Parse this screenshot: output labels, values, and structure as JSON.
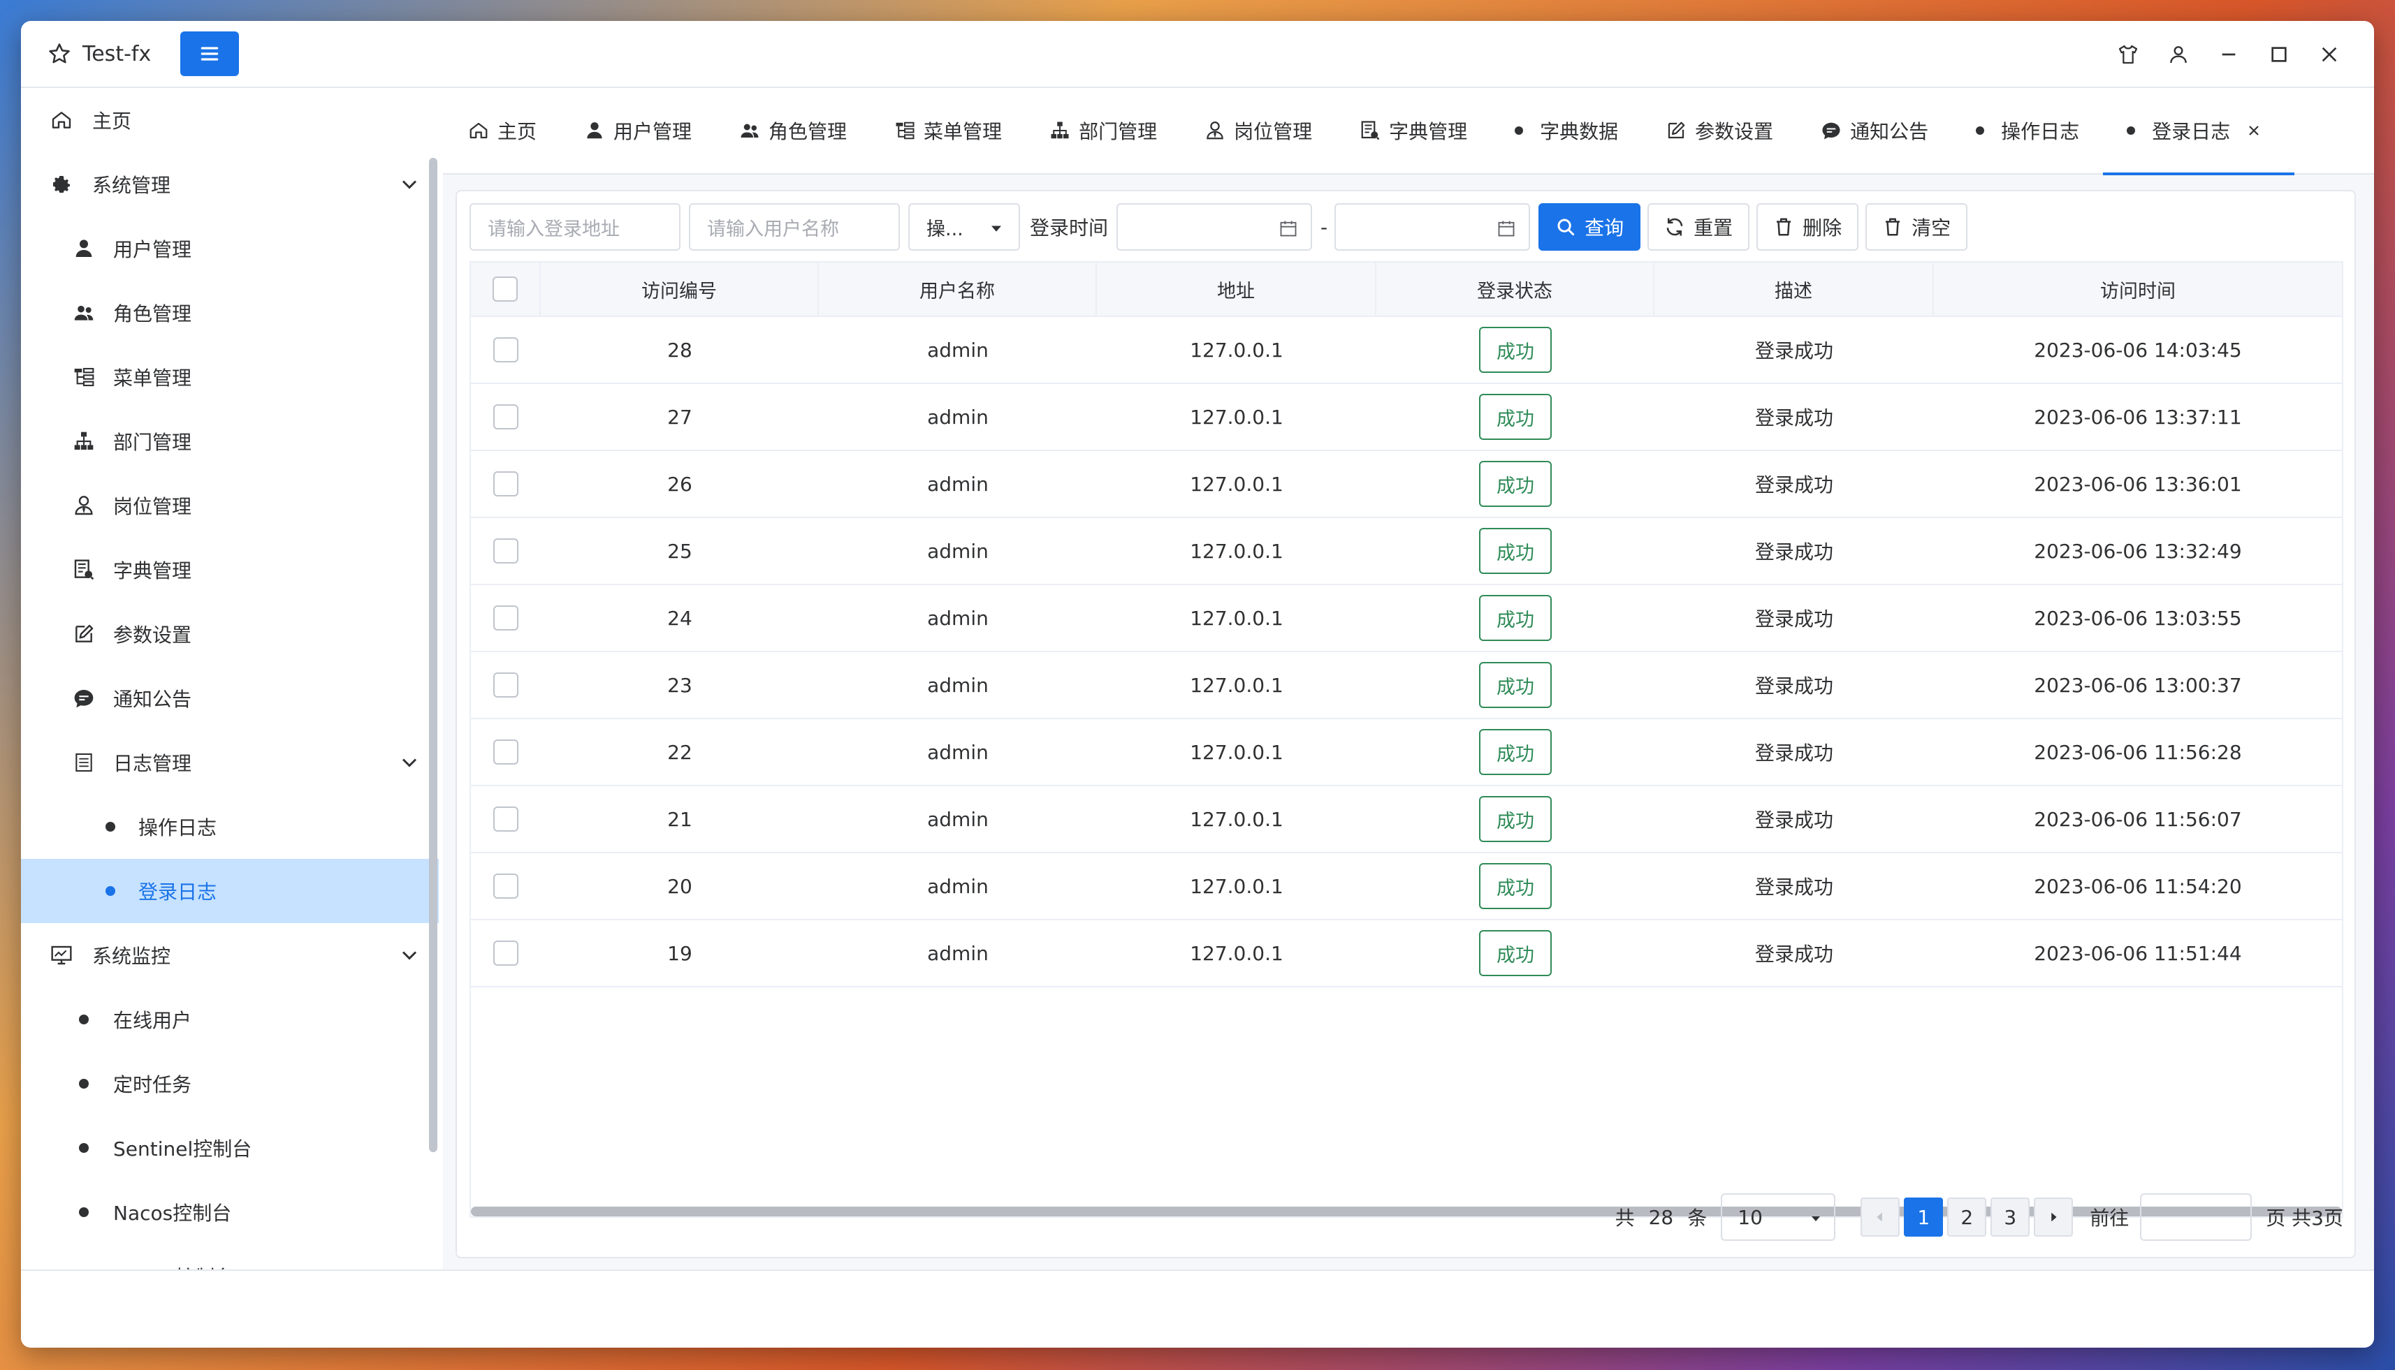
{
  "app": {
    "title": "Test-fx"
  },
  "sidebar": {
    "items": [
      {
        "label": "主页",
        "icon": "home-icon"
      },
      {
        "label": "系统管理",
        "icon": "gear-icon"
      },
      {
        "label": "用户管理",
        "icon": "user-icon"
      },
      {
        "label": "角色管理",
        "icon": "users-icon"
      },
      {
        "label": "菜单管理",
        "icon": "tree-list-icon"
      },
      {
        "label": "部门管理",
        "icon": "sitemap-icon"
      },
      {
        "label": "岗位管理",
        "icon": "user-tie-icon"
      },
      {
        "label": "字典管理",
        "icon": "dictionary-icon"
      },
      {
        "label": "参数设置",
        "icon": "edit-icon"
      },
      {
        "label": "通知公告",
        "icon": "comment-icon"
      },
      {
        "label": "日志管理",
        "icon": "log-icon"
      },
      {
        "label": "操作日志",
        "icon": "dot-icon"
      },
      {
        "label": "登录日志",
        "icon": "dot-icon"
      },
      {
        "label": "系统监控",
        "icon": "monitor-icon"
      },
      {
        "label": "在线用户",
        "icon": "dot-icon"
      },
      {
        "label": "定时任务",
        "icon": "dot-icon"
      },
      {
        "label": "Sentinel控制台",
        "icon": "dot-icon"
      },
      {
        "label": "Nacos控制台",
        "icon": "dot-icon"
      },
      {
        "label": "Admin控制台",
        "icon": "dot-icon"
      }
    ]
  },
  "tabs": [
    {
      "label": "主页",
      "icon": "home-icon"
    },
    {
      "label": "用户管理",
      "icon": "user-icon"
    },
    {
      "label": "角色管理",
      "icon": "users-icon"
    },
    {
      "label": "菜单管理",
      "icon": "tree-list-icon"
    },
    {
      "label": "部门管理",
      "icon": "sitemap-icon"
    },
    {
      "label": "岗位管理",
      "icon": "user-tie-icon"
    },
    {
      "label": "字典管理",
      "icon": "dictionary-icon"
    },
    {
      "label": "字典数据",
      "icon": "dot-icon"
    },
    {
      "label": "参数设置",
      "icon": "edit-icon"
    },
    {
      "label": "通知公告",
      "icon": "comment-icon"
    },
    {
      "label": "操作日志",
      "icon": "dot-icon"
    },
    {
      "label": "登录日志",
      "icon": "dot-icon",
      "active": true
    }
  ],
  "filters": {
    "address_placeholder": "请输入登录地址",
    "username_placeholder": "请输入用户名称",
    "status_value": "操...",
    "time_label": "登录时间",
    "range_separator": "-",
    "query": "查询",
    "reset": "重置",
    "delete": "删除",
    "clear": "清空"
  },
  "table": {
    "columns": [
      "访问编号",
      "用户名称",
      "地址",
      "登录状态",
      "描述",
      "访问时间"
    ],
    "rows": [
      {
        "id": "28",
        "user": "admin",
        "addr": "127.0.0.1",
        "status": "成功",
        "desc": "登录成功",
        "time": "2023-06-06 14:03:45"
      },
      {
        "id": "27",
        "user": "admin",
        "addr": "127.0.0.1",
        "status": "成功",
        "desc": "登录成功",
        "time": "2023-06-06 13:37:11"
      },
      {
        "id": "26",
        "user": "admin",
        "addr": "127.0.0.1",
        "status": "成功",
        "desc": "登录成功",
        "time": "2023-06-06 13:36:01"
      },
      {
        "id": "25",
        "user": "admin",
        "addr": "127.0.0.1",
        "status": "成功",
        "desc": "登录成功",
        "time": "2023-06-06 13:32:49"
      },
      {
        "id": "24",
        "user": "admin",
        "addr": "127.0.0.1",
        "status": "成功",
        "desc": "登录成功",
        "time": "2023-06-06 13:03:55"
      },
      {
        "id": "23",
        "user": "admin",
        "addr": "127.0.0.1",
        "status": "成功",
        "desc": "登录成功",
        "time": "2023-06-06 13:00:37"
      },
      {
        "id": "22",
        "user": "admin",
        "addr": "127.0.0.1",
        "status": "成功",
        "desc": "登录成功",
        "time": "2023-06-06 11:56:28"
      },
      {
        "id": "21",
        "user": "admin",
        "addr": "127.0.0.1",
        "status": "成功",
        "desc": "登录成功",
        "time": "2023-06-06 11:56:07"
      },
      {
        "id": "20",
        "user": "admin",
        "addr": "127.0.0.1",
        "status": "成功",
        "desc": "登录成功",
        "time": "2023-06-06 11:54:20"
      },
      {
        "id": "19",
        "user": "admin",
        "addr": "127.0.0.1",
        "status": "成功",
        "desc": "登录成功",
        "time": "2023-06-06 11:51:44"
      }
    ]
  },
  "pagination": {
    "total_prefix": "共",
    "total": "28",
    "total_suffix": "条",
    "page_size": "10",
    "pages": [
      "1",
      "2",
      "3"
    ],
    "current": "1",
    "goto_label": "前往",
    "page_suffix": "页 共3页"
  },
  "colors": {
    "accent": "#1a73e8",
    "success": "#2e8b57",
    "active_menu_bg": "#c6e2ff"
  }
}
